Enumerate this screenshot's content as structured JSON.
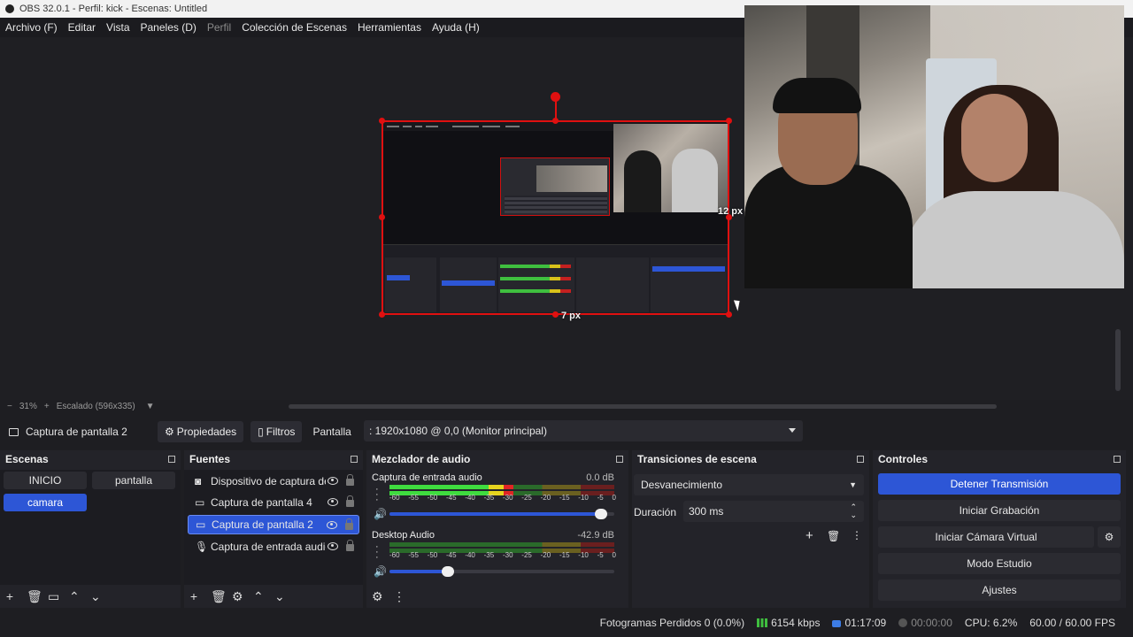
{
  "window": {
    "title": "OBS 32.0.1 - Perfil: kick - Escenas: Untitled"
  },
  "menu": [
    {
      "label": "Archivo (F)",
      "enabled": true
    },
    {
      "label": "Editar",
      "enabled": true
    },
    {
      "label": "Vista",
      "enabled": true
    },
    {
      "label": "Paneles (D)",
      "enabled": true
    },
    {
      "label": "Perfil",
      "enabled": false
    },
    {
      "label": "Colección de Escenas",
      "enabled": true
    },
    {
      "label": "Herramientas",
      "enabled": true
    },
    {
      "label": "Ayuda (H)",
      "enabled": true
    }
  ],
  "preview": {
    "selection_right_label": "12 px",
    "selection_bottom_label": "7 px"
  },
  "zoom": {
    "percent": "31%",
    "plus": "+",
    "minus": "−",
    "scale_label": "Escalado (596x335)"
  },
  "props_bar": {
    "source_name": "Captura de pantalla 2",
    "properties_label": "Propiedades",
    "filters_label": "Filtros",
    "screen_label": "Pantalla",
    "screen_value": ": 1920x1080 @ 0,0 (Monitor principal)"
  },
  "scenes": {
    "title": "Escenas",
    "items": [
      "INICIO",
      "pantalla",
      "camara"
    ],
    "active": "camara"
  },
  "sources": {
    "title": "Fuentes",
    "items": [
      {
        "label": "Dispositivo de captura de",
        "icon": "camera-icon"
      },
      {
        "label": "Captura de pantalla 4",
        "icon": "monitor-icon"
      },
      {
        "label": "Captura de pantalla 2",
        "icon": "monitor-icon"
      },
      {
        "label": "Captura de entrada audic",
        "icon": "microphone-icon"
      }
    ],
    "active_index": 2
  },
  "mixer": {
    "title": "Mezclador de audio",
    "ticks": [
      "-60",
      "-55",
      "-50",
      "-45",
      "-40",
      "-35",
      "-30",
      "-25",
      "-20",
      "-15",
      "-10",
      "-5",
      "0"
    ],
    "channels": [
      {
        "name": "Captura de entrada audio",
        "db": "0.0 dB",
        "level": 0.55,
        "volume": 0.94
      },
      {
        "name": "Desktop Audio",
        "db": "-42.9 dB",
        "level": 0.0,
        "volume": 0.26
      }
    ]
  },
  "transitions": {
    "title": "Transiciones de escena",
    "selected": "Desvanecimiento",
    "duration_label": "Duración",
    "duration_value": "300 ms"
  },
  "controls": {
    "title": "Controles",
    "buttons": [
      "Detener Transmisión",
      "Iniciar Grabación",
      "Iniciar Cámara Virtual",
      "Modo Estudio",
      "Ajustes"
    ]
  },
  "status": {
    "dropped": "Fotogramas Perdidos 0 (0.0%)",
    "bitrate": "6154 kbps",
    "live_time": "01:17:09",
    "rec_time": "00:00:00",
    "cpu": "CPU: 6.2%",
    "fps": "60.00 / 60.00 FPS"
  },
  "colors": {
    "accent": "#2d56d6",
    "selection": "#e01010",
    "background": "#1e1e22"
  }
}
